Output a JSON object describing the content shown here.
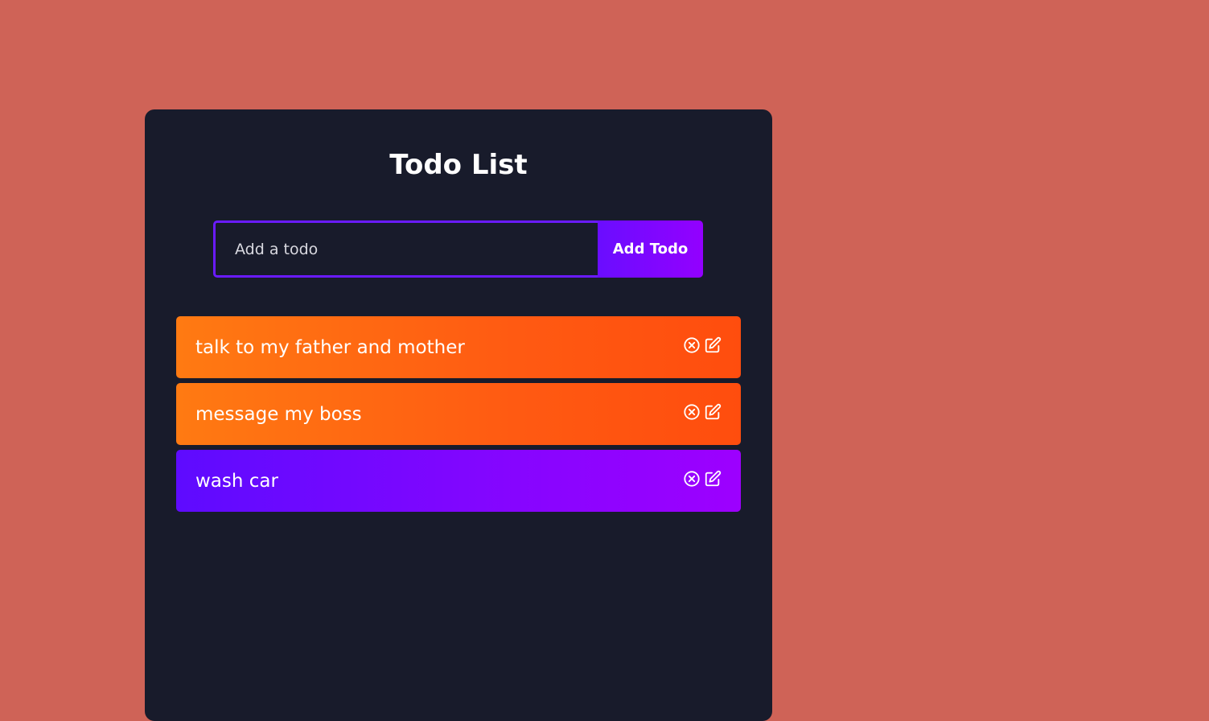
{
  "header": {
    "title": "Todo List"
  },
  "form": {
    "input_placeholder": "Add a todo",
    "input_value": "",
    "add_button_label": "Add Todo"
  },
  "todos": [
    {
      "text": "talk to my father and mother",
      "style": "orange",
      "icons": [
        "delete-icon",
        "edit-icon"
      ]
    },
    {
      "text": "message my boss",
      "style": "orange",
      "icons": [
        "delete-icon",
        "edit-icon"
      ]
    },
    {
      "text": "wash car",
      "style": "purple",
      "icons": [
        "delete-icon",
        "edit-icon"
      ]
    }
  ],
  "colors": {
    "page_background": "#cf6357",
    "app_background": "#181b2b",
    "accent_purple": "#6a1bff",
    "todo_orange": "#ff6a12",
    "todo_purple": "#8605ff",
    "text": "#ffffff"
  }
}
